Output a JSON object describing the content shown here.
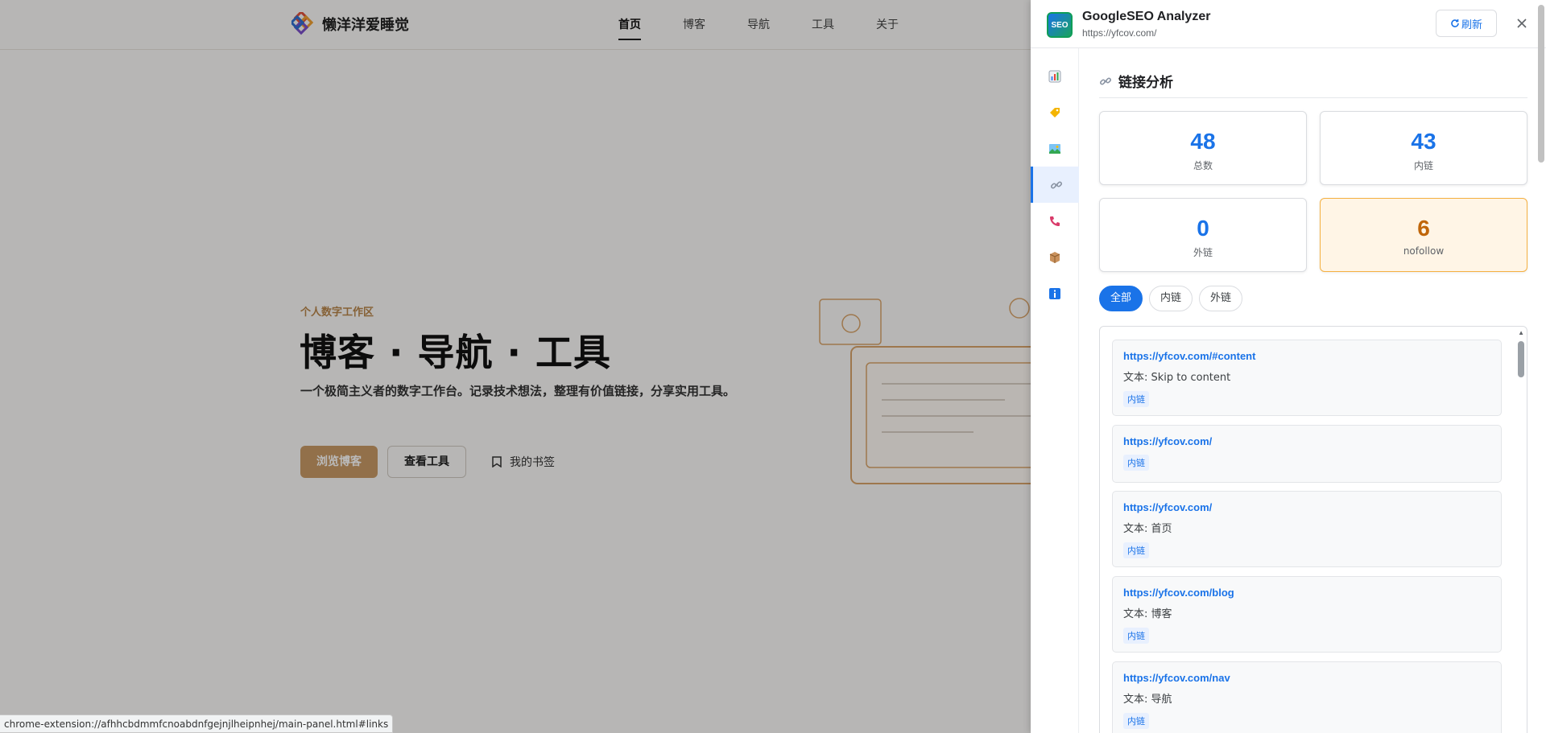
{
  "site": {
    "logo_text": "懒洋洋爱睡觉",
    "nav": [
      "首页",
      "博客",
      "导航",
      "工具",
      "关于"
    ],
    "hero": {
      "kicker": "个人数字工作区",
      "title": "博客 · 导航 · 工具",
      "desc": "一个极简主义者的数字工作台。记录技术想法，整理有价值链接，分享实用工具。",
      "btn_blog": "浏览博客",
      "btn_tools": "查看工具",
      "btn_bookmarks": "我的书签"
    }
  },
  "statusbar": {
    "url": "chrome-extension://afhhcbdmmfcnoabdnfgejnjlheipnhej/main-panel.html#links"
  },
  "panel": {
    "logo_text": "SEO",
    "title": "GoogleSEO Analyzer",
    "url": "https://yfcov.com/",
    "refresh_label": "刷新",
    "sidebar_icons": [
      "chart-icon",
      "tag-icon",
      "image-icon",
      "link-icon",
      "phone-icon",
      "package-icon",
      "info-icon"
    ],
    "section_title": "链接分析",
    "stats": [
      {
        "value": "48",
        "label": "总数"
      },
      {
        "value": "43",
        "label": "内链"
      },
      {
        "value": "0",
        "label": "外链"
      },
      {
        "value": "6",
        "label": "nofollow"
      }
    ],
    "tabs": [
      "全部",
      "内链",
      "外链"
    ],
    "links": [
      {
        "url": "https://yfcov.com/#content",
        "text": "文本: Skip to content",
        "badge": "内链"
      },
      {
        "url": "https://yfcov.com/",
        "text": "",
        "badge": "内链"
      },
      {
        "url": "https://yfcov.com/",
        "text": "文本: 首页",
        "badge": "内链"
      },
      {
        "url": "https://yfcov.com/blog",
        "text": "文本: 博客",
        "badge": "内链"
      },
      {
        "url": "https://yfcov.com/nav",
        "text": "文本: 导航",
        "badge": "内链"
      }
    ],
    "colors": {
      "accent": "#1a73e8",
      "warn_bg": "#fff5e6",
      "warn_text": "#c0660a"
    }
  }
}
